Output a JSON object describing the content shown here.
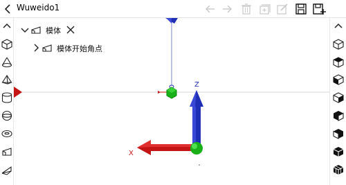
{
  "app": {
    "title": "Wuweido1"
  },
  "toolbar": {
    "icons": [
      "back-arrow-icon",
      "forward-arrow-icon",
      "trash-icon",
      "add-layer-icon",
      "edit-icon",
      "save-icon",
      "save-as-icon"
    ]
  },
  "tree": {
    "root": {
      "label": "模体",
      "expanded": true
    },
    "child": {
      "label": "模体开始角点",
      "expanded": false
    }
  },
  "axes": {
    "z": "Z",
    "x": "X"
  },
  "colors": {
    "z_axis": "#1f2fb5",
    "x_axis": "#c41414",
    "origin": "#19b019",
    "grid_line": "#d8d8d8"
  }
}
